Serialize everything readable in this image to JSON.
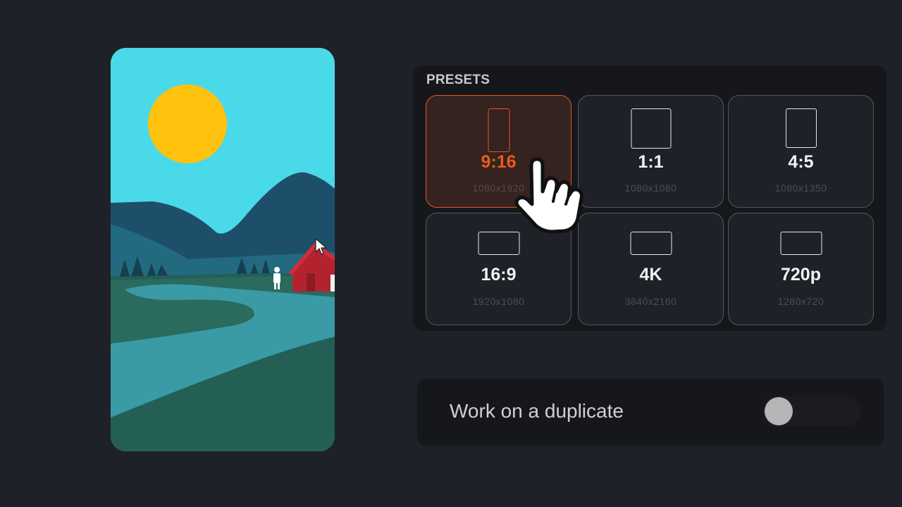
{
  "presets": {
    "title": "PRESETS",
    "selected_index": 0,
    "items": [
      {
        "ratio": "9:16",
        "resolution": "1080x1920",
        "icon": "portrait-frame-icon"
      },
      {
        "ratio": "1:1",
        "resolution": "1080x1080",
        "icon": "square-frame-icon"
      },
      {
        "ratio": "4:5",
        "resolution": "1080x1350",
        "icon": "portrait-frame-icon"
      },
      {
        "ratio": "16:9",
        "resolution": "1920x1080",
        "icon": "landscape-frame-icon"
      },
      {
        "ratio": "4K",
        "resolution": "3840x2160",
        "icon": "landscape-frame-icon"
      },
      {
        "ratio": "720p",
        "resolution": "1280x720",
        "icon": "landscape-frame-icon"
      }
    ]
  },
  "duplicate_option": {
    "label": "Work on a duplicate",
    "enabled": false
  },
  "colors": {
    "accent": "#e8561c",
    "background": "#1f2128",
    "panel": "#16171b"
  }
}
